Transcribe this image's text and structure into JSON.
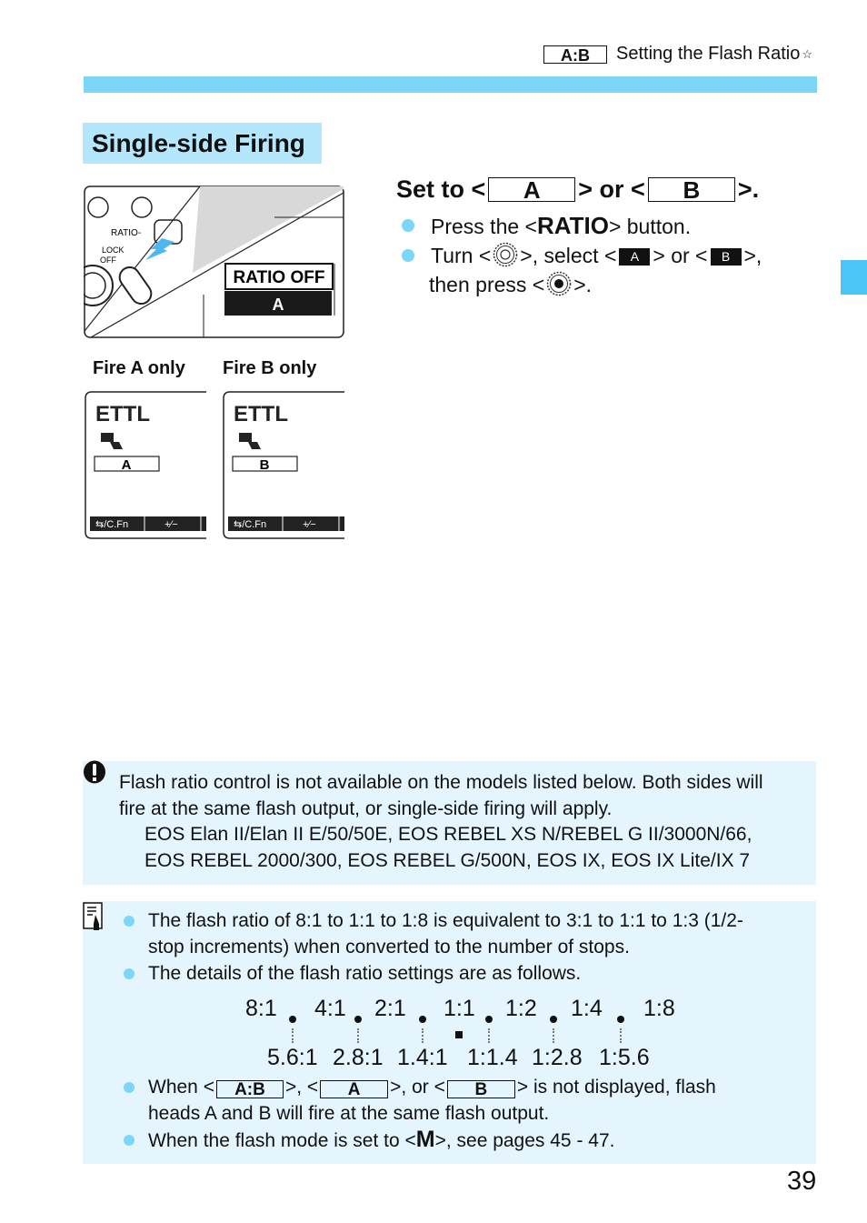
{
  "header": {
    "badge": "A:B",
    "title": "Setting the Flash Ratio",
    "star": "☆"
  },
  "section_title": "Single-side Firing",
  "figure_main": {
    "button_label": "RATIO",
    "switch_label_lock": "LOCK",
    "switch_label_off": "OFF",
    "lcd_top": "RATIO OFF",
    "lcd_selected": "A"
  },
  "step": {
    "title_pre": "Set to <",
    "box_a": "A",
    "title_mid": "> or <",
    "box_b": "B",
    "title_post": ">.",
    "bullets": [
      {
        "pre": "Press the <",
        "bold": "RATIO",
        "post": "> button."
      },
      {
        "pre": "Turn <",
        "mid1": ">, select <",
        "blk_a": "A",
        "mid2": "> or <",
        "blk_b": "B",
        "post": ">,",
        "line2_pre": "then press <",
        "line2_post": ">."
      }
    ]
  },
  "lcd_panels": [
    {
      "caption": "Fire A only",
      "mode": "ETTL",
      "group": "A",
      "tab1": "/C.Fn",
      "tab2": "+/−"
    },
    {
      "caption": "Fire B only",
      "mode": "ETTL",
      "group": "B",
      "tab1": "/C.Fn",
      "tab2": "+/−"
    }
  ],
  "caution": {
    "icon": "caution-icon",
    "line1": "Flash ratio control is not available on the models listed below. Both sides will",
    "line2": "fire at the same flash output, or single-side firing will apply.",
    "models1": "EOS Elan II/Elan II E/50/50E, EOS REBEL XS N/REBEL G II/3000N/66,",
    "models2": "EOS REBEL 2000/300, EOS REBEL G/500N, EOS IX, EOS IX Lite/IX 7"
  },
  "note": {
    "icon": "memo-icon",
    "bullet1_l1": "The flash ratio of 8:1 to 1:1 to 1:8 is equivalent to 3:1 to 1:1 to 1:3 (1/2-",
    "bullet1_l2": "stop increments) when converted to the number of stops.",
    "bullet2": "The details of the flash ratio settings are as follows.",
    "ratios_full": [
      "8:1",
      "4:1",
      "2:1",
      "1:1",
      "1:2",
      "1:4",
      "1:8"
    ],
    "ratios_half": [
      "5.6:1",
      "2.8:1",
      "1.4:1",
      "1:1.4",
      "1:2.8",
      "1:5.6"
    ],
    "bullet3_pre": "When <",
    "bullet3_box1": "A:B",
    "bullet3_mid1": ">, <",
    "bullet3_box2": "A",
    "bullet3_mid2": ">, or <",
    "bullet3_box3": "B",
    "bullet3_post": "> is not displayed, flash",
    "bullet3_l2": "heads A and B will fire at the same flash output.",
    "bullet4_pre": "When the flash mode is set to <",
    "bullet4_bold": "M",
    "bullet4_post": ">, see pages 45 - 47."
  },
  "page_number": "39",
  "colors": {
    "accent_bar": "#7dd6f7",
    "section_bg": "#b4e7fb",
    "note_bg": "#e5f5fd",
    "side_tab": "#4cc4f5"
  }
}
